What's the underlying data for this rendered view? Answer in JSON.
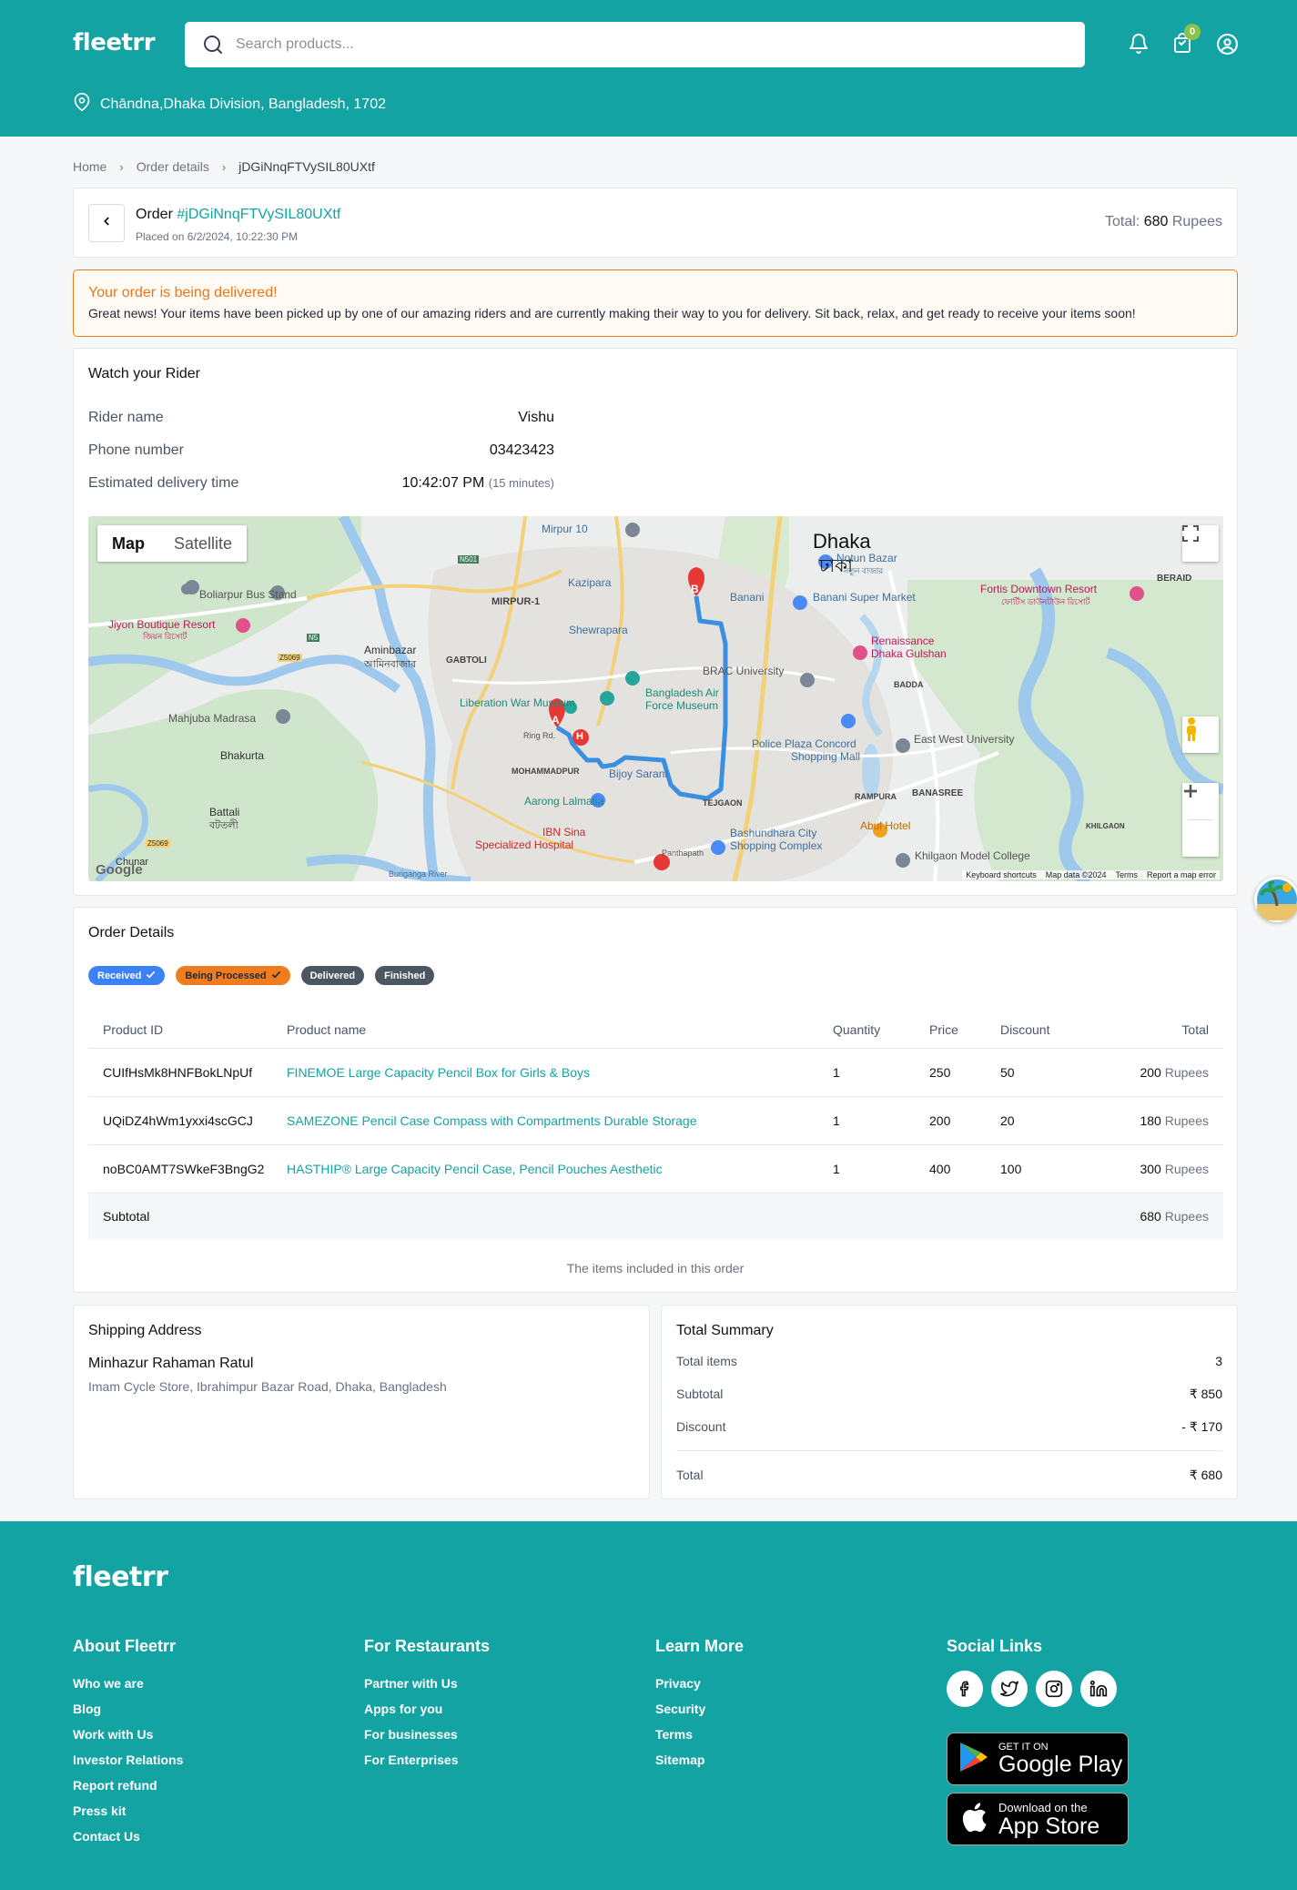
{
  "header": {
    "logo": "fleetrr",
    "search_placeholder": "Search products...",
    "cart_count": "0",
    "location": "Chāndna,Dhaka Division, Bangladesh, 1702"
  },
  "breadcrumb": [
    "Home",
    "Order details",
    "jDGiNnqFTVySIL80UXtf"
  ],
  "order": {
    "label": "Order",
    "id": "#jDGiNnqFTVySIL80UXtf",
    "placed": "Placed on 6/2/2024, 10:22:30 PM",
    "total_label": "Total:",
    "total_value": "680",
    "total_unit": "Rupees"
  },
  "alert": {
    "title": "Your order is being delivered!",
    "body": "Great news! Your items have been picked up by one of our amazing riders and are currently making their way to you for delivery. Sit back, relax, and get ready to receive your items soon!"
  },
  "rider": {
    "title": "Watch your Rider",
    "name_label": "Rider name",
    "name": "Vishu",
    "phone_label": "Phone number",
    "phone": "03423423",
    "eta_label": "Estimated delivery time",
    "eta": "10:42:07 PM",
    "eta_note": "(15 minutes)"
  },
  "map": {
    "tab_map": "Map",
    "tab_satellite": "Satellite",
    "city": "Dhaka",
    "city_bn": "ঢাকা",
    "labels": {
      "mirpur10": "Mirpur 10",
      "boliarpur": "Boliarpur Bus Stand",
      "jiyon": "Jiyon Boutique Resort",
      "jiyon_bn": "জিয়ন রিসোর্ট",
      "aminbazar": "Aminbazar",
      "aminbazar_bn": "আমিনবাজার",
      "gabtoli": "GABTOLI",
      "mirpur1": "MIRPUR-1",
      "kazipara": "Kazipara",
      "shewrapara": "Shewrapara",
      "liberation": "Liberation War Museum",
      "mahjuba": "Mahjuba Madrasa",
      "bhakurta": "Bhakurta",
      "battali": "Battali",
      "battali_bn": "বটতলী",
      "notun": "Notun Bazar",
      "notun_bn": "নতুন বাজার",
      "fortis": "Fortis Downtown Resort",
      "fortis_bn": "ফোর্টিস ডাউনটাউন রিসোর্ট",
      "beraid": "BERAID",
      "banani": "Banani",
      "banani_market": "Banani Super Market",
      "brac": "BRAC University",
      "renaissance": "Renaissance",
      "renaissance2": "Dhaka Gulshan",
      "badda": "BADDA",
      "airforce": "Bangladesh Air",
      "airforce2": "Force Museum",
      "police": "Police Plaza Concord",
      "police2": "Shopping Mall",
      "eastwest": "East West University",
      "banasree": "BANASREE",
      "mohammadpur": "MOHAMMADPUR",
      "bijoy": "Bijoy Sarani",
      "aarong": "Aarong Lalmatia",
      "ibn": "IBN Sina",
      "ibn2": "Specialized Hospital",
      "tejgaon": "TEJGAON",
      "bashundhara": "Bashundhara City",
      "bashundhara2": "Shopping Complex",
      "rampura": "RAMPURA",
      "abul": "Abul Hotel",
      "khilgaon": "Khilgaon Model College",
      "khilgaon_area": "KHILGAON",
      "panthapath": "Panthapath",
      "chunar": "Chunar",
      "buriganga": "Buriganga River",
      "ring": "Ring Rd.",
      "n501": "N501",
      "n5": "N5",
      "z5069": "Z5069"
    },
    "pin_a": "A",
    "pin_b": "B",
    "pin_h": "H",
    "footer_shortcuts": "Keyboard shortcuts",
    "footer_data": "Map data ©2024",
    "footer_terms": "Terms",
    "footer_report": "Report a map error",
    "google": "Google"
  },
  "order_details": {
    "title": "Order Details",
    "statuses": [
      {
        "label": "Received",
        "color": "#3b82f6",
        "checked": true
      },
      {
        "label": "Being Processed",
        "color": "#f07c1e",
        "checked": true
      },
      {
        "label": "Delivered",
        "color": "#4b5563",
        "checked": false
      },
      {
        "label": "Finished",
        "color": "#4b5563",
        "checked": false
      }
    ],
    "columns": [
      "Product ID",
      "Product name",
      "Quantity",
      "Price",
      "Discount",
      "Total"
    ],
    "rows": [
      {
        "id": "CUIfHsMk8HNFBokLNpUf",
        "name": "FINEMOE Large Capacity Pencil Box for Girls & Boys",
        "qty": "1",
        "price": "250",
        "discount": "50",
        "total": "200",
        "unit": "Rupees"
      },
      {
        "id": "UQiDZ4hWm1yxxi4scGCJ",
        "name": "SAMEZONE Pencil Case Compass with Compartments Durable Storage",
        "qty": "1",
        "price": "200",
        "discount": "20",
        "total": "180",
        "unit": "Rupees"
      },
      {
        "id": "noBC0AMT7SWkeF3BngG2",
        "name": "HASTHIP® Large Capacity Pencil Case, Pencil Pouches Aesthetic",
        "qty": "1",
        "price": "400",
        "discount": "100",
        "total": "300",
        "unit": "Rupees"
      }
    ],
    "subtotal_label": "Subtotal",
    "subtotal_value": "680",
    "subtotal_unit": "Rupees",
    "caption": "The items included in this order"
  },
  "shipping": {
    "title": "Shipping Address",
    "name": "Minhazur Rahaman Ratul",
    "address": "Imam Cycle Store, Ibrahimpur Bazar Road, Dhaka, Bangladesh"
  },
  "summary": {
    "title": "Total Summary",
    "items_label": "Total items",
    "items_value": "3",
    "subtotal_label": "Subtotal",
    "subtotal_value": "₹ 850",
    "discount_label": "Discount",
    "discount_value": "- ₹ 170",
    "total_label": "Total",
    "total_value": "₹ 680"
  },
  "footer": {
    "logo": "fleetrr",
    "about": {
      "title": "About Fleetrr",
      "links": [
        "Who we are",
        "Blog",
        "Work with Us",
        "Investor Relations",
        "Report refund",
        "Press kit",
        "Contact Us"
      ]
    },
    "restaurants": {
      "title": "For Restaurants",
      "links": [
        "Partner with Us",
        "Apps for you",
        "For businesses",
        "For Enterprises"
      ]
    },
    "learn": {
      "title": "Learn More",
      "links": [
        "Privacy",
        "Security",
        "Terms",
        "Sitemap"
      ]
    },
    "social": {
      "title": "Social Links",
      "icons": [
        "facebook-icon",
        "twitter-icon",
        "instagram-icon",
        "linkedin-icon"
      ]
    },
    "google_play": {
      "small": "GET IT ON",
      "big": "Google Play"
    },
    "app_store": {
      "small": "Download on the",
      "big": "App Store"
    }
  },
  "colors": {
    "brand": "#14a3a3",
    "warning": "#e8781a",
    "link": "#14a3a3",
    "route": "#3b8fe0",
    "pin": "#e53935"
  }
}
